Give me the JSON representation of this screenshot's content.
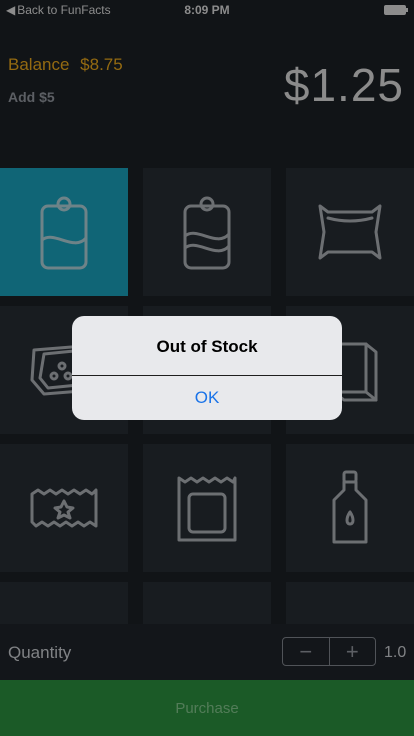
{
  "status_bar": {
    "back_label": "Back to FunFacts",
    "time": "8:09 PM"
  },
  "header": {
    "balance_label": "Balance",
    "balance_value": "$8.75",
    "add_funds": "Add $5",
    "price": "$1.25"
  },
  "products": [
    {
      "icon": "soda-can-icon",
      "selected": true
    },
    {
      "icon": "soda-can-icon",
      "selected": false
    },
    {
      "icon": "chip-bag-icon",
      "selected": false
    },
    {
      "icon": "cookie-pack-icon",
      "selected": false
    },
    {
      "icon": "snack-icon",
      "selected": false
    },
    {
      "icon": "box-icon",
      "selected": false
    },
    {
      "icon": "candy-bar-icon",
      "selected": false
    },
    {
      "icon": "snack-bag-icon",
      "selected": false
    },
    {
      "icon": "water-bottle-icon",
      "selected": false
    },
    {
      "icon": "can-icon",
      "selected": false
    },
    {
      "icon": "can-icon",
      "selected": false
    },
    {
      "icon": "empty-slot",
      "selected": false
    }
  ],
  "quantity": {
    "label": "Quantity",
    "minus": "−",
    "plus": "+",
    "value": "1.0"
  },
  "purchase": {
    "label": "Purchase"
  },
  "alert": {
    "title": "Out of Stock",
    "ok_label": "OK"
  },
  "colors": {
    "accent": "#e3a31b",
    "selected_tile": "#1a9bb5",
    "purchase": "#2a8a3c",
    "link": "#1a73e8"
  }
}
